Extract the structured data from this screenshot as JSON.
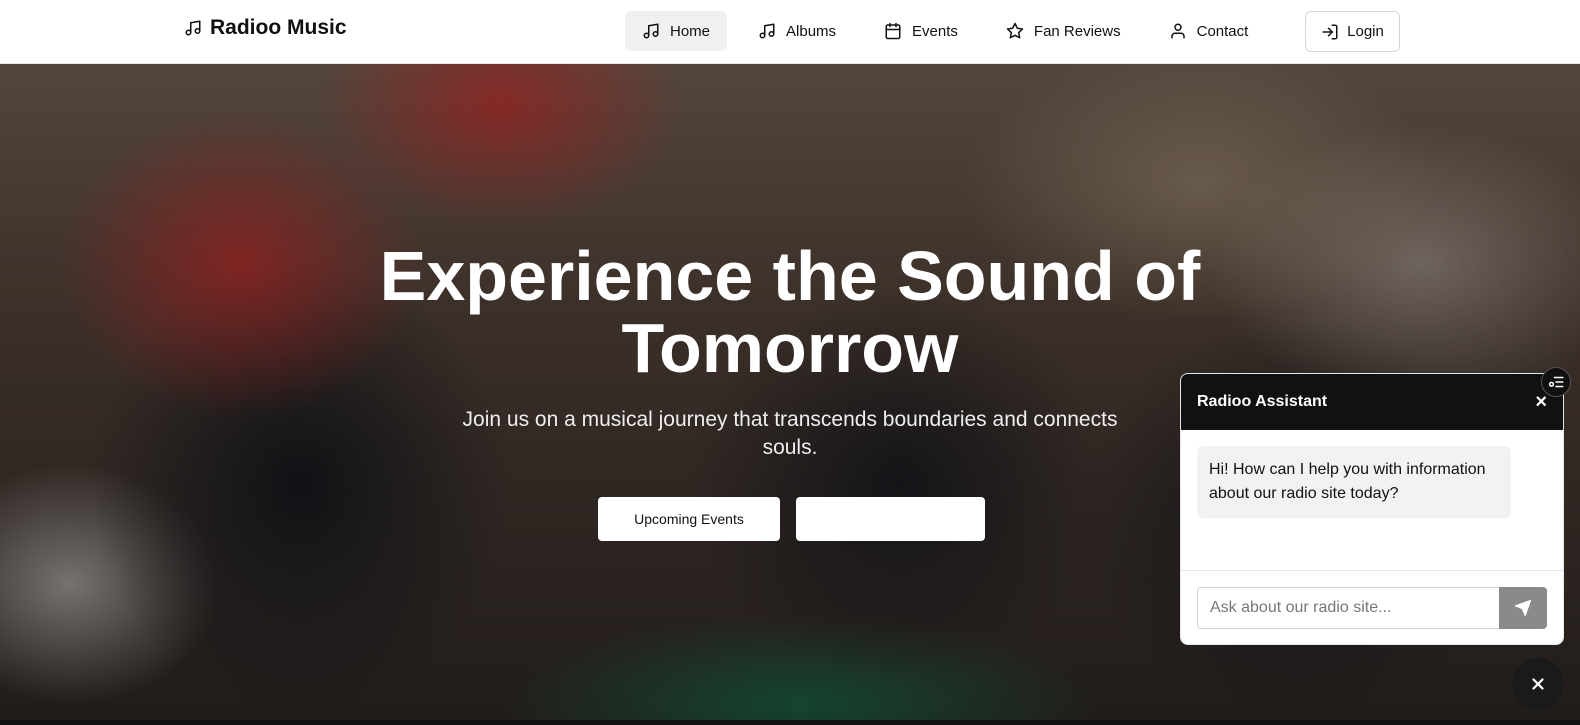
{
  "brand": {
    "name": "Radioo Music",
    "icon": "music-note-icon"
  },
  "nav": {
    "items": [
      {
        "label": "Home",
        "icon": "music-note-icon",
        "active": true
      },
      {
        "label": "Albums",
        "icon": "music-note-icon",
        "active": false
      },
      {
        "label": "Events",
        "icon": "calendar-icon",
        "active": false
      },
      {
        "label": "Fan Reviews",
        "icon": "star-icon",
        "active": false
      },
      {
        "label": "Contact",
        "icon": "user-icon",
        "active": false
      }
    ],
    "login_label": "Login"
  },
  "hero": {
    "title": "Experience the Sound of Tomorrow",
    "subtitle": "Join us on a musical journey that transcends boundaries and connects souls.",
    "primary_button": "Upcoming Events",
    "secondary_button": ""
  },
  "chat": {
    "title": "Radioo Assistant",
    "close_label": "×",
    "greeting": "Hi! How can I help you with information about our radio site today?",
    "input_placeholder": "Ask about our radio site..."
  },
  "colors": {
    "header_bg": "#ffffff",
    "chat_header": "#111111",
    "send_button": "#8a8a8a"
  }
}
